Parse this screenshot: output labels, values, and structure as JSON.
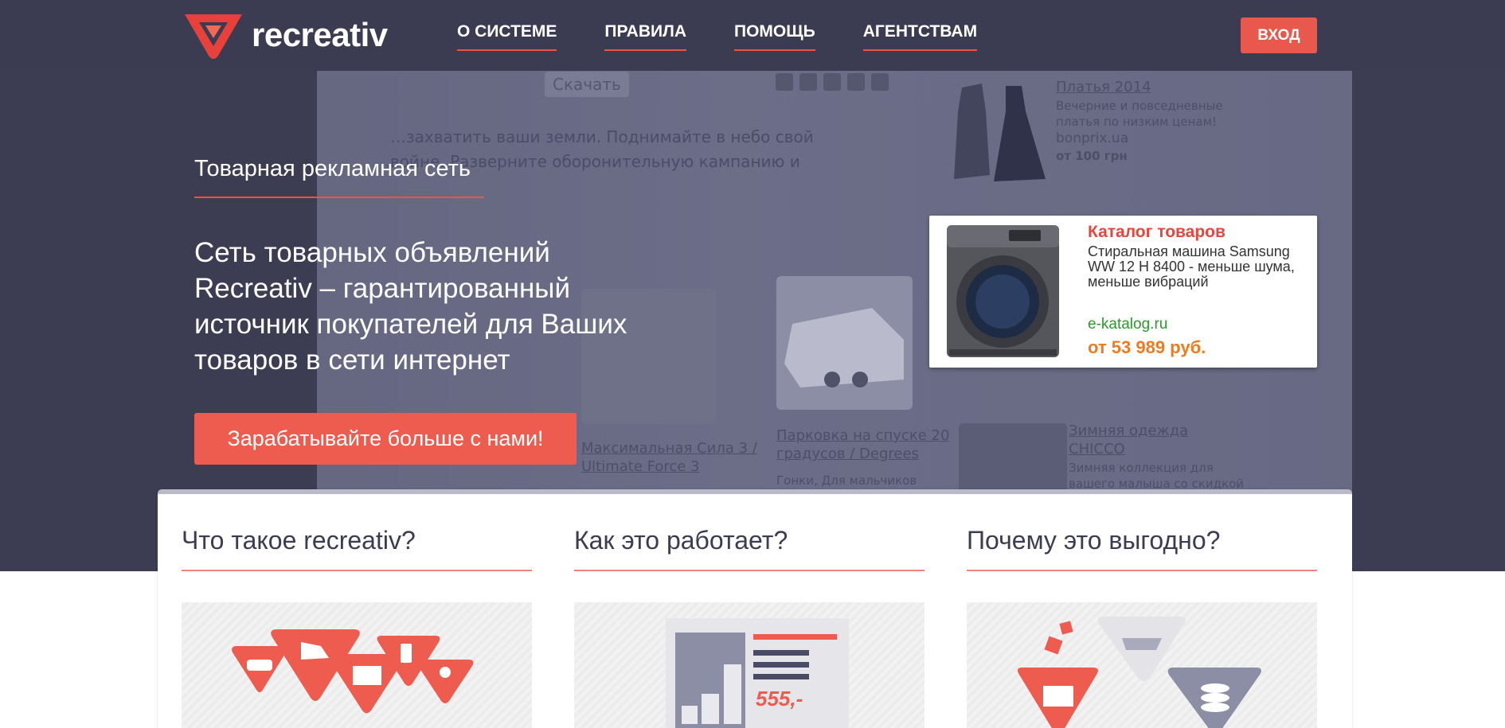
{
  "brand": {
    "name": "recreativ",
    "accent": "#e8544b"
  },
  "nav": {
    "items": [
      "О СИСТЕМЕ",
      "ПРАВИЛА",
      "ПОМОЩЬ",
      "АГЕНТСТВАМ"
    ],
    "login": "ВХОД"
  },
  "hero": {
    "tagline": "Товарная рекламная сеть",
    "headline": "Сеть товарных объявлений Recreativ – гарантированный источник покупателей для Ваших товаров в сети интернет",
    "cta": "Зарабатывайте больше с нами!"
  },
  "background": {
    "download": "Скачать",
    "text1": "…захватить ваши земли. Поднимайте в небо свой",
    "text2": "…войне. Разверните оборонительную кампанию и",
    "dress": {
      "title": "Платья 2014",
      "desc": "Вечерние и повседневные платья по низким ценам!",
      "domain": "bonprix.ua",
      "price": "от 100 грн"
    },
    "game": {
      "title": "Максимальная Сила 3 / Ultimate Force 3"
    },
    "car": {
      "title": "Парковка на спуске 20 градусов / Degrees",
      "sub": "Гонки, Для мальчиков"
    },
    "kids": {
      "title": "Зимняя одежда CHICCO",
      "desc": "Зимняя коллекция для вашего малыша со скидкой"
    }
  },
  "ad": {
    "title": "Каталог товаров",
    "desc": "Стиральная машина Samsung WW 12 H 8400 - меньше шума, меньше вибраций",
    "domain": "e-katalog.ru",
    "price": "от 53 989 руб."
  },
  "sections": [
    {
      "title": "Что такое recreativ?",
      "icon": "product-categories-icon"
    },
    {
      "title": "Как это работает?",
      "icon": "ad-block-icon",
      "price": "555,-"
    },
    {
      "title": "Почему это выгодно?",
      "icon": "benefit-icon"
    }
  ]
}
